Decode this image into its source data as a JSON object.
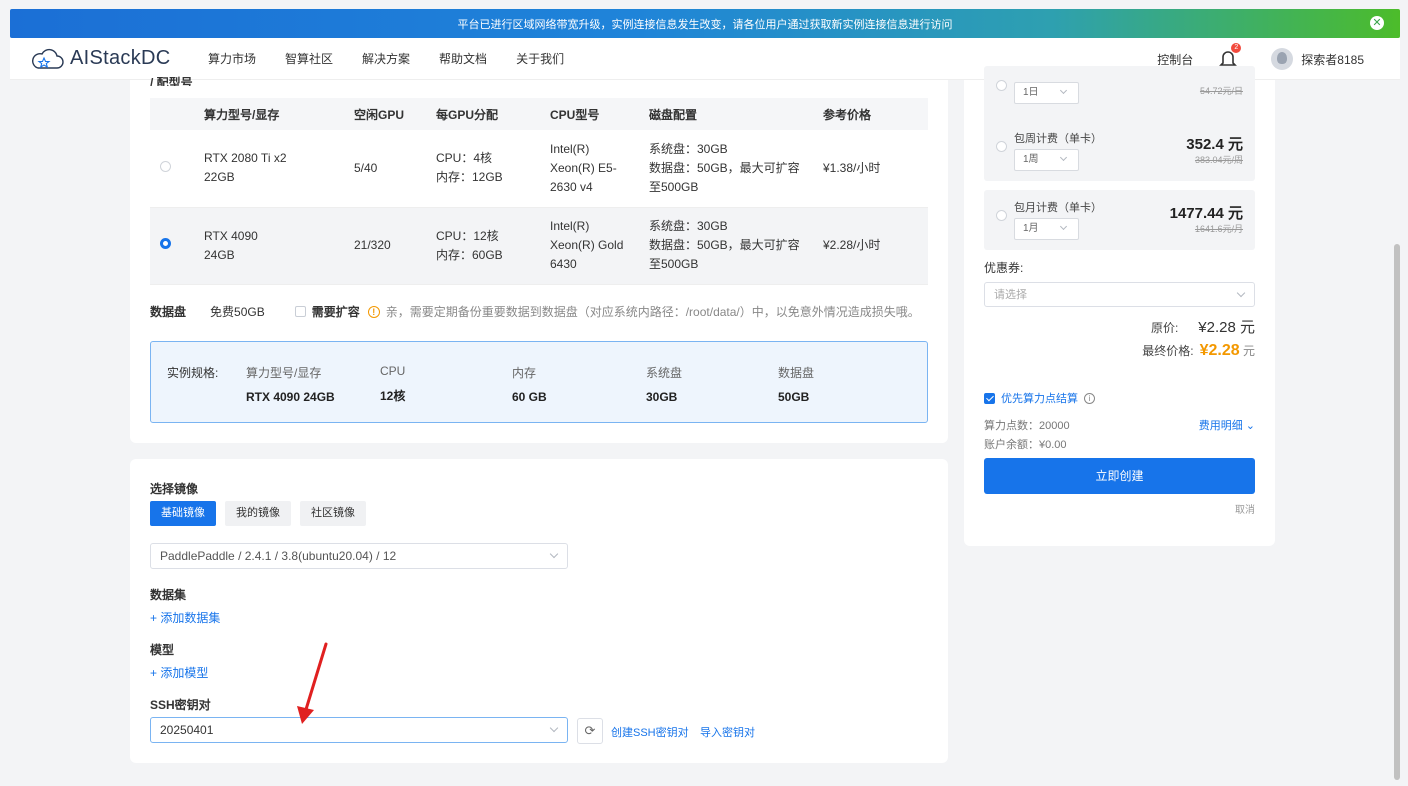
{
  "banner": {
    "text": "平台已进行区域网络带宽升级，实例连接信息发生改变，请各位用户通过获取新实例连接信息进行访问",
    "close_icon": "close-circle-icon"
  },
  "nav": {
    "logo_text": "AIStackDC",
    "links": [
      "算力市场",
      "智算社区",
      "解决方案",
      "帮助文档",
      "关于我们"
    ],
    "console": "控制台",
    "notification_count": "2",
    "username": "探索者8185"
  },
  "gpu": {
    "cut_label": "/ 配型号",
    "headers": [
      "算力型号/显存",
      "空闲GPU",
      "每GPU分配",
      "CPU型号",
      "磁盘配置",
      "参考价格"
    ],
    "rows": [
      {
        "model": "RTX 2080 Ti x2",
        "mem": "22GB",
        "free": "5/40",
        "alloc_cpu": "CPU：4核",
        "alloc_mem": "内存：12GB",
        "cpu1": "Intel(R)",
        "cpu2": "Xeon(R) E5-",
        "cpu3": "2630 v4",
        "disk1": "系统盘：30GB",
        "disk2": "数据盘：50GB，最大可扩容",
        "disk3": "至500GB",
        "price": "¥1.38/小时",
        "selected": false
      },
      {
        "model": "RTX 4090",
        "mem": "24GB",
        "free": "21/320",
        "alloc_cpu": "CPU：12核",
        "alloc_mem": "内存：60GB",
        "cpu1": "Intel(R)",
        "cpu2": "Xeon(R) Gold",
        "cpu3": "6430",
        "disk1": "系统盘：30GB",
        "disk2": "数据盘：50GB，最大可扩容",
        "disk3": "至500GB",
        "price": "¥2.28/小时",
        "selected": true
      }
    ]
  },
  "datadisk": {
    "label": "数据盘",
    "free": "免费50GB",
    "expand": "需要扩容",
    "tip": "亲，需要定期备份重要数据到数据盘（对应系统内路径：/root/data/）中，以免意外情况造成损失哦。"
  },
  "spec": {
    "label": "实例规格:",
    "cols": [
      {
        "h": "算力型号/显存",
        "v": "RTX 4090 24GB"
      },
      {
        "h": "CPU",
        "v": "12核"
      },
      {
        "h": "内存",
        "v": "60 GB"
      },
      {
        "h": "系统盘",
        "v": "30GB"
      },
      {
        "h": "数据盘",
        "v": "50GB"
      }
    ]
  },
  "image": {
    "title": "选择镜像",
    "tabs": [
      "基础镜像",
      "我的镜像",
      "社区镜像"
    ],
    "selected": "PaddlePaddle / 2.4.1 / 3.8(ubuntu20.04) / 12",
    "dataset_title": "数据集",
    "dataset_add": "+ 添加数据集",
    "model_title": "模型",
    "model_add": "+ 添加模型",
    "ssh_title": "SSH密钥对",
    "ssh_value": "20250401",
    "ssh_create": "创建SSH密钥对",
    "ssh_import": "导入密钥对"
  },
  "order": {
    "plans": [
      {
        "name": "",
        "period": "1日",
        "price": "",
        "orig": "54.72元/日"
      },
      {
        "name": "包周计费（单卡）",
        "period": "1周",
        "price": "352.4 元",
        "orig": "383.04元/周"
      },
      {
        "name": "包月计费（单卡）",
        "period": "1月",
        "price": "1477.44 元",
        "orig": "1641.6元/月"
      }
    ],
    "coupon_label": "优惠券:",
    "coupon_placeholder": "请选择",
    "orig_label": "原价:",
    "orig_value": "¥2.28 元",
    "final_label": "最终价格:",
    "final_value": "¥2.28",
    "final_unit": "元",
    "priority": "优先算力点结算",
    "points": "算力点数：20000",
    "balance": "账户余额：¥0.00",
    "fee_detail": "费用明细",
    "create": "立即创建",
    "cancel": "取消"
  },
  "colors": {
    "primary": "#1774ea",
    "price": "#f39800",
    "annotation_arrow": "#e02020"
  }
}
